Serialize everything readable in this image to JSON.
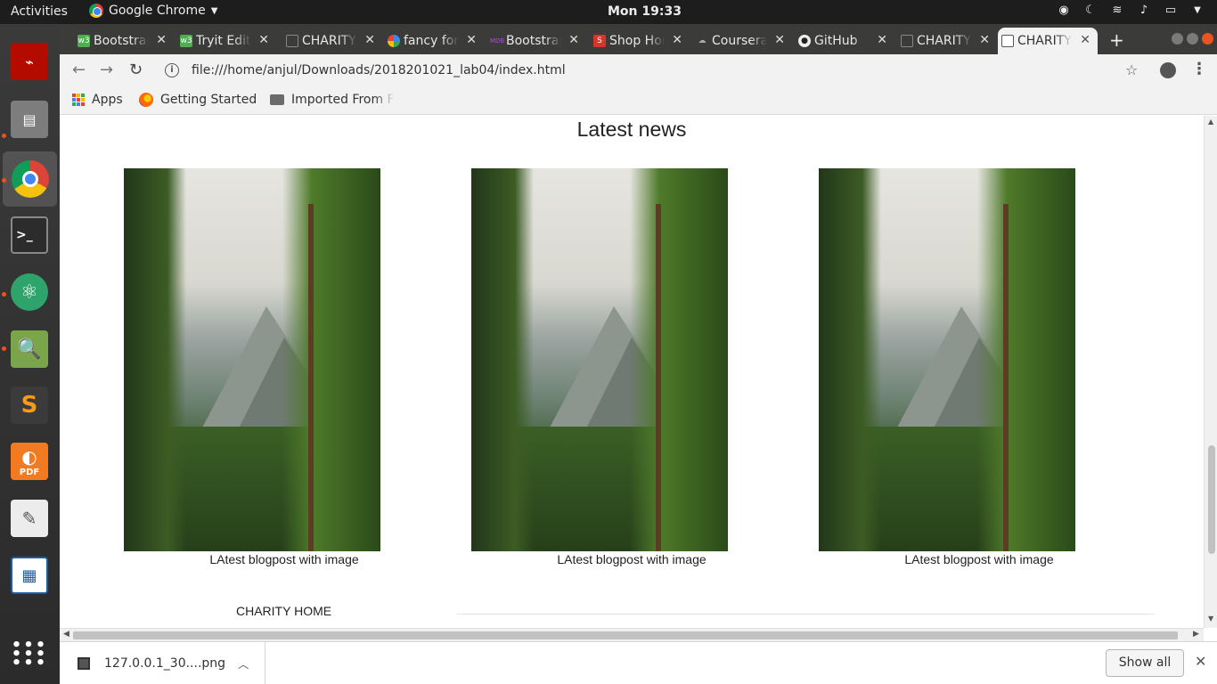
{
  "system": {
    "activities": "Activities",
    "app_name": "Google Chrome",
    "clock": "Mon 19:33"
  },
  "tabs": [
    {
      "title": "Bootstrap",
      "favicon": "w3-icon",
      "active": false
    },
    {
      "title": "Tryit Editor",
      "favicon": "w3-icon",
      "active": false
    },
    {
      "title": "CHARITY",
      "favicon": "page-icon",
      "active": false
    },
    {
      "title": "fancy fonts",
      "favicon": "google-icon",
      "active": false
    },
    {
      "title": "Bootstrap",
      "favicon": "mdb-icon",
      "active": false
    },
    {
      "title": "Shop Home",
      "favicon": "s-icon",
      "active": false
    },
    {
      "title": "Coursera",
      "favicon": "cloud-icon",
      "active": false
    },
    {
      "title": "GitHub",
      "favicon": "github-icon",
      "active": false
    },
    {
      "title": "CHARITY",
      "favicon": "page-icon",
      "active": false
    },
    {
      "title": "CHARITY",
      "favicon": "page-icon",
      "active": true
    }
  ],
  "toolbar": {
    "url": "file:///home/anjul/Downloads/2018201021_lab04/index.html"
  },
  "bookmarks": {
    "apps": "Apps",
    "getting_started": "Getting Started",
    "imported": "Imported From F"
  },
  "page": {
    "title": "Latest news",
    "cards": [
      {
        "caption": "LAtest blogpost with image"
      },
      {
        "caption": "LAtest blogpost with image"
      },
      {
        "caption": "LAtest blogpost with image"
      }
    ],
    "footer_home": "CHARITY HOME"
  },
  "downloads": {
    "file": "127.0.0.1_30....png",
    "show_all": "Show all"
  },
  "colors": {
    "ubuntu_orange": "#e95420",
    "tab_strip": "#3b3b39",
    "toolbar": "#f2f2f2"
  }
}
